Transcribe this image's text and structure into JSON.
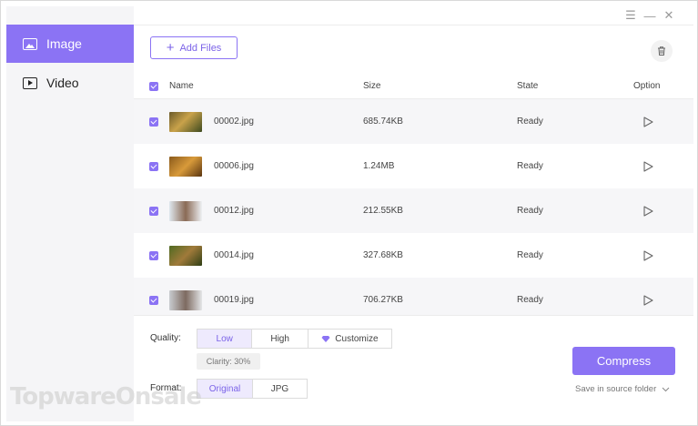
{
  "sidebar": {
    "items": [
      {
        "label": "Image",
        "icon": "image-icon",
        "active": true
      },
      {
        "label": "Video",
        "icon": "video-icon",
        "active": false
      }
    ]
  },
  "window_controls": {
    "menu": "☰",
    "minimize": "—",
    "close": "✕"
  },
  "toolbar": {
    "add_files_label": "Add Files",
    "trash_icon": "trash-icon"
  },
  "table": {
    "headers": {
      "name": "Name",
      "size": "Size",
      "state": "State",
      "option": "Option"
    },
    "rows": [
      {
        "name": "00002.jpg",
        "size": "685.74KB",
        "state": "Ready",
        "checked": true
      },
      {
        "name": "00006.jpg",
        "size": "1.24MB",
        "state": "Ready",
        "checked": true
      },
      {
        "name": "00012.jpg",
        "size": "212.55KB",
        "state": "Ready",
        "checked": true
      },
      {
        "name": "00014.jpg",
        "size": "327.68KB",
        "state": "Ready",
        "checked": true
      },
      {
        "name": "00019.jpg",
        "size": "706.27KB",
        "state": "Ready",
        "checked": true
      }
    ]
  },
  "quality": {
    "label": "Quality:",
    "options": [
      "Low",
      "High",
      "Customize"
    ],
    "selected": "Low",
    "clarity": "Clarity: 30%"
  },
  "format": {
    "label": "Format:",
    "options": [
      "Original",
      "JPG"
    ],
    "selected": "Original"
  },
  "compress_label": "Compress",
  "save_location": "Save in source folder",
  "watermark": "TopwareOnsale",
  "colors": {
    "accent": "#8b73f4",
    "sidebar_bg": "#f5f5f7",
    "row_alt": "#f6f6f8"
  }
}
